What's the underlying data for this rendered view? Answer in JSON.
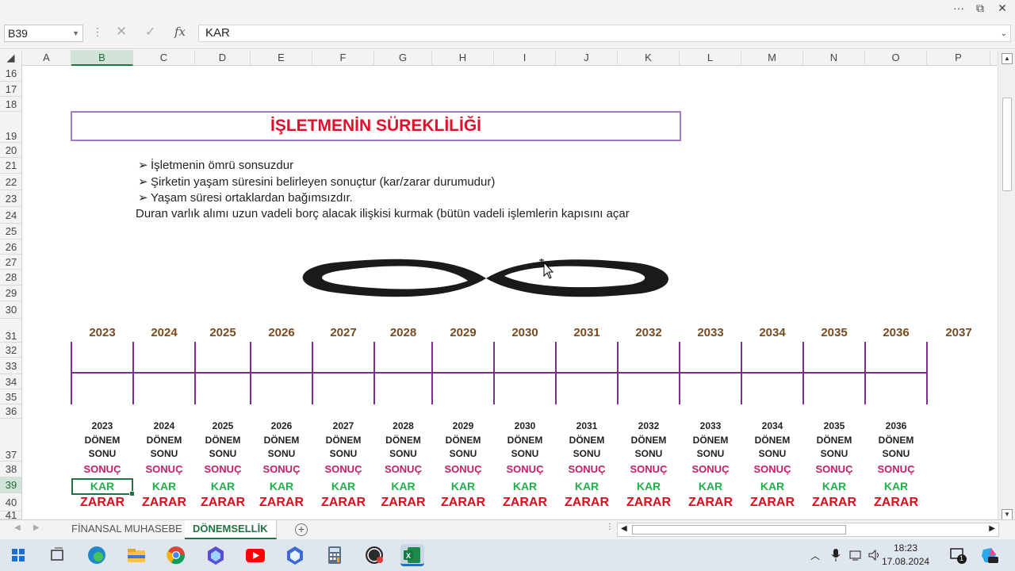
{
  "window": {
    "more_label": "···",
    "restore_label": "⧉",
    "close_label": "✕"
  },
  "formula_bar": {
    "name_box": "B39",
    "fx_label": "fx",
    "cancel_symbol": "✕",
    "confirm_symbol": "✓",
    "content": "KAR"
  },
  "columns": [
    "A",
    "B",
    "C",
    "D",
    "E",
    "F",
    "G",
    "H",
    "I",
    "J",
    "K",
    "L",
    "M",
    "N",
    "O",
    "P"
  ],
  "selected_column": "B",
  "rows": [
    "16",
    "17",
    "18",
    "19",
    "20",
    "21",
    "22",
    "23",
    "24",
    "25",
    "26",
    "27",
    "28",
    "29",
    "30",
    "31",
    "32",
    "33",
    "34",
    "35",
    "36",
    "37",
    "38",
    "39",
    "40",
    "41"
  ],
  "selected_row": "39",
  "sheet": {
    "title": "İŞLETMENİN SÜREKLİLİĞİ",
    "bullets": [
      "İşletmenin ömrü sonsuzdur",
      "Şirketin yaşam süresini belirleyen sonuçtur (kar/zarar durumudur)",
      "Yaşam süresi ortaklardan bağımsızdır."
    ],
    "bullet_marker": "➢",
    "plain_line": "Duran varlık alımı uzun vadeli borç alacak ilişkisi kurmak (bütün vadeli işlemlerin kapısını açar",
    "years": [
      "2023",
      "2024",
      "2025",
      "2026",
      "2027",
      "2028",
      "2029",
      "2030",
      "2031",
      "2032",
      "2033",
      "2034",
      "2035",
      "2036",
      "2037"
    ],
    "period_columns": [
      {
        "year": "2023",
        "line2": "DÖNEM",
        "line3": "SONU",
        "result_label": "SONUÇ",
        "profit": "KAR",
        "loss": "ZARAR"
      },
      {
        "year": "2024",
        "line2": "DÖNEM",
        "line3": "SONU",
        "result_label": "SONUÇ",
        "profit": "KAR",
        "loss": "ZARAR"
      },
      {
        "year": "2025",
        "line2": "DÖNEM",
        "line3": "SONU",
        "result_label": "SONUÇ",
        "profit": "KAR",
        "loss": "ZARAR"
      },
      {
        "year": "2026",
        "line2": "DÖNEM",
        "line3": "SONU",
        "result_label": "SONUÇ",
        "profit": "KAR",
        "loss": "ZARAR"
      },
      {
        "year": "2027",
        "line2": "DÖNEM",
        "line3": "SONU",
        "result_label": "SONUÇ",
        "profit": "KAR",
        "loss": "ZARAR"
      },
      {
        "year": "2028",
        "line2": "DÖNEM",
        "line3": "SONU",
        "result_label": "SONUÇ",
        "profit": "KAR",
        "loss": "ZARAR"
      },
      {
        "year": "2029",
        "line2": "DÖNEM",
        "line3": "SONU",
        "result_label": "SONUÇ",
        "profit": "KAR",
        "loss": "ZARAR"
      },
      {
        "year": "2030",
        "line2": "DÖNEM",
        "line3": "SONU",
        "result_label": "SONUÇ",
        "profit": "KAR",
        "loss": "ZARAR"
      },
      {
        "year": "2031",
        "line2": "DÖNEM",
        "line3": "SONU",
        "result_label": "SONUÇ",
        "profit": "KAR",
        "loss": "ZARAR"
      },
      {
        "year": "2032",
        "line2": "DÖNEM",
        "line3": "SONU",
        "result_label": "SONUÇ",
        "profit": "KAR",
        "loss": "ZARAR"
      },
      {
        "year": "2033",
        "line2": "DÖNEM",
        "line3": "SONU",
        "result_label": "SONUÇ",
        "profit": "KAR",
        "loss": "ZARAR"
      },
      {
        "year": "2034",
        "line2": "DÖNEM",
        "line3": "SONU",
        "result_label": "SONUÇ",
        "profit": "KAR",
        "loss": "ZARAR"
      },
      {
        "year": "2035",
        "line2": "DÖNEM",
        "line3": "SONU",
        "result_label": "SONUÇ",
        "profit": "KAR",
        "loss": "ZARAR"
      },
      {
        "year": "2036",
        "line2": "DÖNEM",
        "line3": "SONU",
        "result_label": "SONUÇ",
        "profit": "KAR",
        "loss": "ZARAR"
      }
    ]
  },
  "tabs": [
    {
      "label": "FİNANSAL MUHASEBE",
      "active": false
    },
    {
      "label": "DÖNEMSELLİK",
      "active": true
    }
  ],
  "add_sheet_label": "+",
  "taskbar": {
    "apps": [
      "windows-start",
      "task-view",
      "edge",
      "file-explorer",
      "chrome",
      "app-blue",
      "youtube",
      "app-blue-2",
      "calculator",
      "obs",
      "excel"
    ],
    "time": "18:23",
    "date": "17.08.2024",
    "notification_count": "1"
  },
  "colors": {
    "title_red": "#e0102c",
    "year_brown": "#7a4a1e",
    "timeline_purple": "#7b2f8c",
    "result_magenta": "#c21f6a",
    "profit_green": "#22b04b",
    "loss_red": "#d7101e",
    "excel_green": "#217346"
  }
}
